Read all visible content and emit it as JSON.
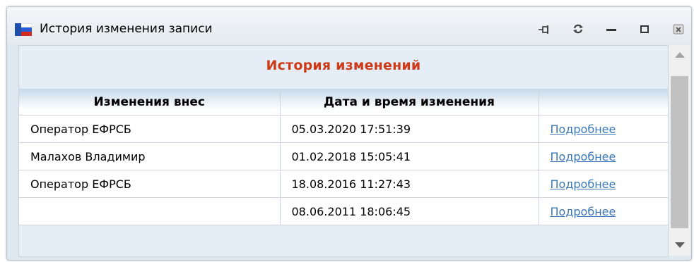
{
  "window": {
    "title": "История изменения записи",
    "icons": [
      "app-flag-icon",
      "pin-icon",
      "refresh-icon",
      "minimize-icon",
      "maximize-icon",
      "close-icon"
    ]
  },
  "heading": "История изменений",
  "table": {
    "headers": [
      "Изменения внес",
      "Дата и время изменения",
      ""
    ],
    "rows": [
      {
        "author": "Оператор ЕФРСБ",
        "datetime": "05.03.2020 17:51:39",
        "link": "Подробнее"
      },
      {
        "author": "Малахов Владимир",
        "datetime": "01.02.2018 15:05:41",
        "link": "Подробнее"
      },
      {
        "author": "Оператор ЕФРСБ",
        "datetime": "18.08.2016 11:27:43",
        "link": "Подробнее"
      },
      {
        "author": "",
        "datetime": "08.06.2011 18:06:45",
        "link": "Подробнее"
      }
    ]
  },
  "colors": {
    "heading": "#cc3a17",
    "link": "#3a78b5",
    "content_bg": "#e5eef7"
  }
}
